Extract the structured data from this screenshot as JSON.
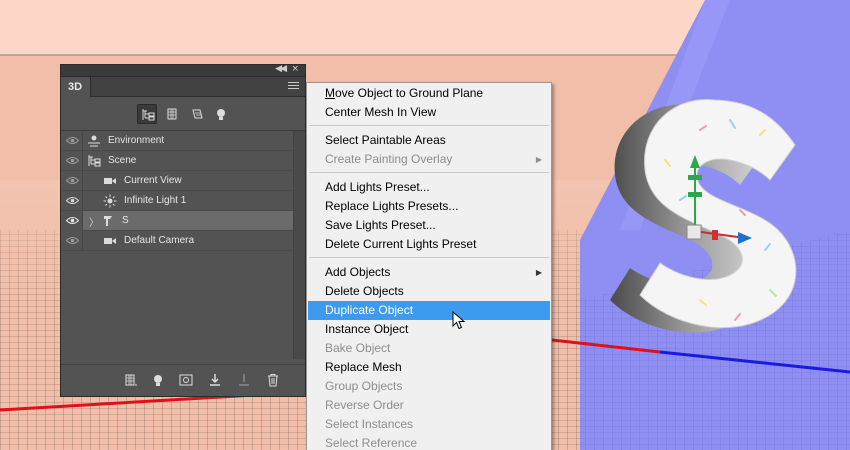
{
  "panel": {
    "tab_label": "3D",
    "filters": [
      {
        "name": "whole-scene-filter",
        "active": true
      },
      {
        "name": "meshes-filter",
        "active": false
      },
      {
        "name": "materials-filter",
        "active": false
      },
      {
        "name": "lights-filter",
        "active": false
      }
    ],
    "layers": [
      {
        "label": "Environment",
        "icon": "environment-icon",
        "selected": false
      },
      {
        "label": "Scene",
        "icon": "scene-icon",
        "selected": false
      },
      {
        "label": "Current View",
        "icon": "camera-icon",
        "selected": false
      },
      {
        "label": "Infinite Light 1",
        "icon": "light-icon",
        "selected": false
      },
      {
        "label": "S",
        "icon": "mesh-icon",
        "selected": true
      },
      {
        "label": "Default Camera",
        "icon": "camera-icon",
        "selected": false
      }
    ],
    "bottom_icons": [
      "new-mesh-icon",
      "new-light-icon",
      "render-icon",
      "ground-plane-icon",
      "constraint-icon",
      "delete-icon"
    ]
  },
  "menu": {
    "items": [
      {
        "label": "Move Object to Ground Plane",
        "mnemonic": "M",
        "disabled": false
      },
      {
        "label": "Center Mesh In View",
        "disabled": false
      },
      {
        "label": "Select Paintable Areas",
        "disabled": false
      },
      {
        "label": "Create Painting Overlay",
        "disabled": true,
        "submenu": true
      },
      {
        "label": "Add Lights Preset...",
        "disabled": false
      },
      {
        "label": "Replace Lights Presets...",
        "disabled": false
      },
      {
        "label": "Save Lights Preset...",
        "disabled": false
      },
      {
        "label": "Delete Current Lights Preset",
        "disabled": false
      },
      {
        "label": "Add Objects",
        "disabled": false,
        "submenu": true
      },
      {
        "label": "Delete Objects",
        "disabled": false
      },
      {
        "label": "Duplicate Object",
        "disabled": false,
        "highlighted": true
      },
      {
        "label": "Instance Object",
        "disabled": false
      },
      {
        "label": "Bake Object",
        "disabled": true
      },
      {
        "label": "Replace Mesh",
        "disabled": false
      },
      {
        "label": "Group Objects",
        "disabled": true
      },
      {
        "label": "Reverse Order",
        "disabled": true
      },
      {
        "label": "Select Instances",
        "disabled": true
      },
      {
        "label": "Select Reference",
        "disabled": true
      }
    ]
  },
  "colors": {
    "panel_bg": "#535353",
    "menu_highlight": "#3c9bef",
    "background_peach": "#f4c9b6",
    "plane_blue": "#8c8cf2",
    "axis_red": "#e0101a",
    "axis_blue": "#1a1ae0"
  }
}
